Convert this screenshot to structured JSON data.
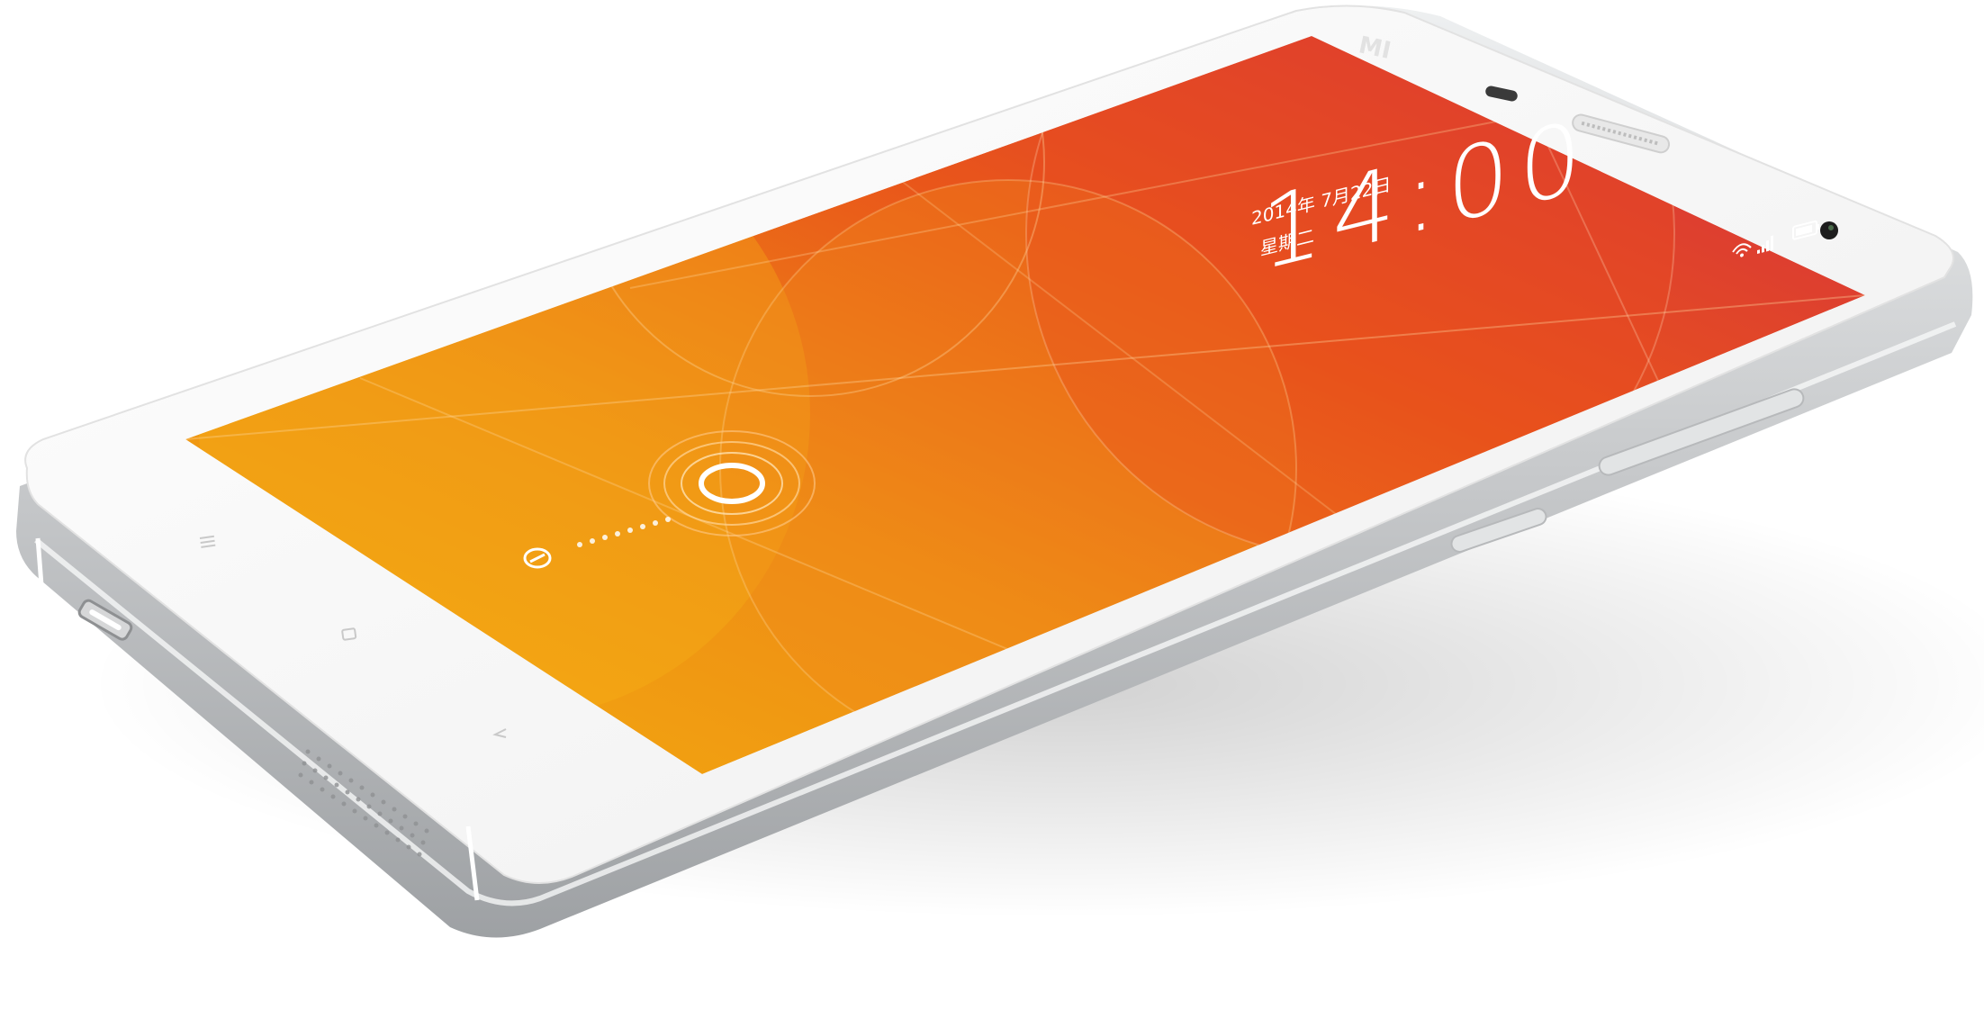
{
  "product": {
    "brand_logo_text": "MI",
    "body_color": "#f7f7f7",
    "frame_color": "#c9cbcd"
  },
  "lock_screen": {
    "time": "14:00",
    "date_line": "2014年 7月22日",
    "weekday": "星期二",
    "wallpaper_colors": [
      "#f2a70f",
      "#ef8a16",
      "#e8521a",
      "#d93a3a",
      "#d8335a"
    ],
    "unlock_ring_icon": "unlock-ring-icon",
    "unlock_target_icon": "lock-target-icon"
  },
  "status_bar": {
    "icons": [
      "wifi-icon",
      "signal-icon",
      "battery-icon"
    ]
  },
  "nav_keys": {
    "icons": [
      "menu-icon",
      "home-icon",
      "back-icon"
    ]
  }
}
